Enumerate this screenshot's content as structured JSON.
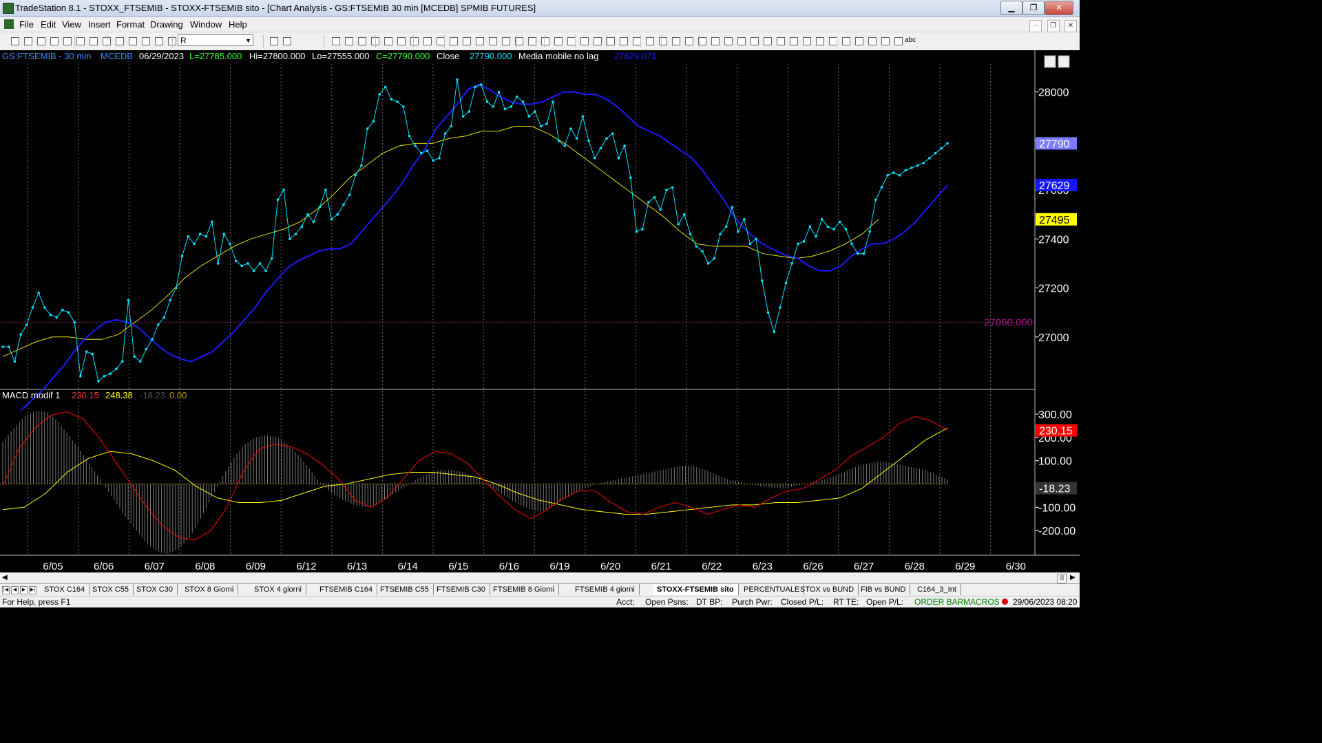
{
  "window": {
    "title": "TradeStation 8.1 - STOXX_FTSEMIB - STOXX-FTSEMIB sito - [Chart Analysis - GS:FTSEMIB  30 min  [MCEDB] SPMIB FUTURES]",
    "minimize": "▁",
    "restore": "❐",
    "close": "✕"
  },
  "menu": [
    "File",
    "Edit",
    "View",
    "Insert",
    "Format",
    "Drawing",
    "Window",
    "Help"
  ],
  "mdi_buttons": [
    "-",
    "❐",
    "✕"
  ],
  "toolbar": {
    "symbol_value": "R",
    "abc_label": "abc"
  },
  "chart_header": {
    "symbol": "GS:FTSEMIB - 30 min",
    "exchange": "MCEDB",
    "date": "06/29/2023",
    "last": "L=27785.000",
    "high": "Hi=27800.000",
    "low": "Lo=27555.000",
    "close": "C=27790.000",
    "close_label": "Close",
    "close_value": "27790.000",
    "indicator": "Media mobile no lag",
    "indicator_value": "27629.071"
  },
  "price_axis": {
    "ticks": [
      "28000",
      "27800",
      "27600",
      "27400",
      "27200",
      "27000"
    ],
    "badges": [
      {
        "text": "27790",
        "bg": "#7b7bff",
        "fg": "#ffffff"
      },
      {
        "text": "27629",
        "bg": "#1414ff",
        "fg": "#ffffff"
      },
      {
        "text": "27495",
        "bg": "#ffff00",
        "fg": "#000000"
      }
    ],
    "horizontal_line_label": "27060.000"
  },
  "macd_header": {
    "name": "MACD modif 1",
    "v1": "230.15",
    "v2": "248.38",
    "v3": "-18.23",
    "v4": "0.00"
  },
  "macd_axis": {
    "ticks": [
      "300.00",
      "200.00",
      "100.00",
      "-100.00",
      "-200.00"
    ],
    "badges": [
      {
        "text": "230.15",
        "bg": "#ff0000",
        "fg": "#ffffff"
      },
      {
        "text": "-18.23",
        "bg": "#333333",
        "fg": "#ffffff"
      }
    ]
  },
  "date_axis": [
    "6/05",
    "6/06",
    "6/07",
    "6/08",
    "6/09",
    "6/12",
    "6/13",
    "6/14",
    "6/15",
    "6/16",
    "6/19",
    "6/20",
    "6/21",
    "6/22",
    "6/23",
    "6/26",
    "6/27",
    "6/28",
    "6/29",
    "6/30"
  ],
  "tabs": [
    "STOX C164",
    "STOX C55",
    "STOX  C30",
    "STOX  8 Giorni",
    "STOX 4 giorni",
    "FTSEMIB C164",
    "FTSEMIB C55",
    "FTSEMIB C30",
    "FTSEMIB  8 Giorni",
    "FTSEMIB  4 giorni",
    "STOXX-FTSEMIB sito",
    "PERCENTUALE",
    "STOX vs BUND",
    "FIB vs BUND",
    "C164_3_Int"
  ],
  "active_tab": "STOXX-FTSEMIB sito",
  "status": {
    "help": "For Help, press F1",
    "acct": "Acct:",
    "open_psns": "Open Psns:",
    "dt_bp": "DT BP:",
    "purch_pwr": "Purch Pwr:",
    "closed_pl": "Closed P/L:",
    "rt_te": "RT TE:",
    "open_pl": "Open P/L:",
    "order_bar": "ORDER BAR",
    "macros": "MACROS",
    "datetime": "29/06/2023 08:20"
  },
  "colors": {
    "price": "#00e5ff",
    "ma_blue": "#1a1aff",
    "ma_yellow": "#e6e600",
    "macd_red": "#ff0000",
    "macd_signal": "#ffff00",
    "histogram": "#7a7a7a",
    "grid_day": "#6a6a6a",
    "label_green": "#33ff33",
    "status_green": "#008000"
  },
  "chart_data": {
    "type": "line",
    "price_panel": {
      "ylim": [
        26800,
        28100
      ],
      "horizontal_line": 27060,
      "close_series": [
        26960,
        26960,
        26900,
        27010,
        27050,
        27120,
        27180,
        27120,
        27090,
        27080,
        27110,
        27100,
        27060,
        26840,
        26940,
        26930,
        26820,
        26840,
        26850,
        26870,
        26900,
        27150,
        26920,
        26900,
        26950,
        26990,
        27050,
        27080,
        27150,
        27200,
        27330,
        27410,
        27380,
        27420,
        27410,
        27470,
        27300,
        27420,
        27380,
        27310,
        27290,
        27300,
        27270,
        27300,
        27270,
        27320,
        27560,
        27600,
        27400,
        27420,
        27450,
        27500,
        27470,
        27530,
        27600,
        27480,
        27500,
        27540,
        27580,
        27660,
        27700,
        27850,
        27880,
        27990,
        28020,
        27970,
        27960,
        27940,
        27820,
        27780,
        27750,
        27760,
        27720,
        27730,
        27830,
        27860,
        28050,
        27900,
        27920,
        28020,
        28030,
        27960,
        27940,
        28000,
        27930,
        27940,
        27980,
        27960,
        27900,
        27920,
        27860,
        27870,
        27960,
        27800,
        27780,
        27850,
        27810,
        27900,
        27800,
        27730,
        27770,
        27810,
        27830,
        27730,
        27780,
        27650,
        27430,
        27440,
        27550,
        27570,
        27520,
        27600,
        27610,
        27460,
        27500,
        27420,
        27370,
        27350,
        27300,
        27320,
        27420,
        27450,
        27530,
        27430,
        27480,
        27380,
        27400,
        27230,
        27100,
        27020,
        27120,
        27220,
        27300,
        27380,
        27390,
        27450,
        27410,
        27480,
        27450,
        27440,
        27470,
        27440,
        27380,
        27340,
        27340,
        27430,
        27560,
        27610,
        27660,
        27670,
        27660,
        27680,
        27690,
        27700,
        27710,
        27730,
        27750,
        27770,
        27790
      ],
      "ma_blue_series": [
        26700,
        26740,
        26780,
        26830,
        26880,
        26940,
        26990,
        27030,
        27060,
        27070,
        27060,
        27040,
        27000,
        26960,
        26930,
        26910,
        26900,
        26920,
        26940,
        26980,
        27020,
        27070,
        27120,
        27180,
        27230,
        27280,
        27310,
        27330,
        27350,
        27360,
        27360,
        27380,
        27430,
        27480,
        27530,
        27580,
        27640,
        27710,
        27770,
        27850,
        27900,
        27950,
        28010,
        28030,
        28010,
        27980,
        27960,
        27950,
        27950,
        27960,
        27980,
        28000,
        28000,
        27990,
        27990,
        27970,
        27940,
        27900,
        27860,
        27840,
        27820,
        27790,
        27760,
        27730,
        27680,
        27620,
        27560,
        27490,
        27440,
        27400,
        27370,
        27350,
        27330,
        27320,
        27290,
        27270,
        27270,
        27290,
        27330,
        27360,
        27380,
        27380,
        27400,
        27430,
        27470,
        27520,
        27570,
        27620
      ],
      "ma_yellow_series": [
        26920,
        26950,
        26980,
        27000,
        27000,
        26990,
        26990,
        27010,
        27060,
        27110,
        27170,
        27240,
        27290,
        27330,
        27370,
        27400,
        27420,
        27440,
        27470,
        27520,
        27580,
        27650,
        27700,
        27750,
        27780,
        27790,
        27790,
        27810,
        27820,
        27840,
        27840,
        27860,
        27860,
        27830,
        27790,
        27740,
        27690,
        27640,
        27590,
        27540,
        27490,
        27430,
        27380,
        27370,
        27370,
        27370,
        27340,
        27330,
        27320,
        27330,
        27350,
        27380,
        27420,
        27480
      ]
    },
    "macd_panel": {
      "ylim": [
        -300,
        350
      ],
      "histogram": [
        180,
        240,
        290,
        315,
        310,
        270,
        210,
        150,
        80,
        10,
        -60,
        -130,
        -190,
        -250,
        -290,
        -300,
        -280,
        -230,
        -150,
        -60,
        30,
        110,
        170,
        200,
        210,
        200,
        170,
        120,
        60,
        0,
        -40,
        -70,
        -90,
        -100,
        -90,
        -60,
        -30,
        0,
        30,
        50,
        60,
        60,
        50,
        30,
        0,
        -30,
        -60,
        -90,
        -110,
        -120,
        -100,
        -70,
        -40,
        -20,
        0,
        10,
        20,
        30,
        40,
        50,
        60,
        70,
        80,
        75,
        60,
        40,
        20,
        10,
        0,
        -10,
        -15,
        -20,
        -10,
        0,
        10,
        20,
        40,
        60,
        80,
        90,
        95,
        90,
        80,
        70,
        60,
        40,
        20
      ],
      "macd_line": [
        -10,
        150,
        240,
        295,
        310,
        280,
        200,
        100,
        0,
        -100,
        -180,
        -230,
        -240,
        -200,
        -100,
        50,
        150,
        170,
        160,
        130,
        80,
        20,
        -70,
        -100,
        -60,
        20,
        100,
        140,
        130,
        90,
        20,
        -50,
        -110,
        -150,
        -110,
        -60,
        -30,
        -30,
        -80,
        -120,
        -130,
        -100,
        -80,
        -100,
        -130,
        -110,
        -90,
        -100,
        -60,
        -30,
        -20,
        20,
        60,
        120,
        160,
        200,
        260,
        290,
        270,
        230
      ],
      "signal_line": [
        -110,
        -100,
        -40,
        50,
        110,
        140,
        130,
        100,
        60,
        -10,
        -60,
        -80,
        -80,
        -70,
        -40,
        -10,
        0,
        20,
        40,
        50,
        50,
        40,
        30,
        0,
        -40,
        -70,
        -90,
        -110,
        -120,
        -130,
        -130,
        -120,
        -110,
        -100,
        -90,
        -90,
        -80,
        -80,
        -70,
        -60,
        -20,
        50,
        120,
        190,
        240
      ]
    }
  }
}
